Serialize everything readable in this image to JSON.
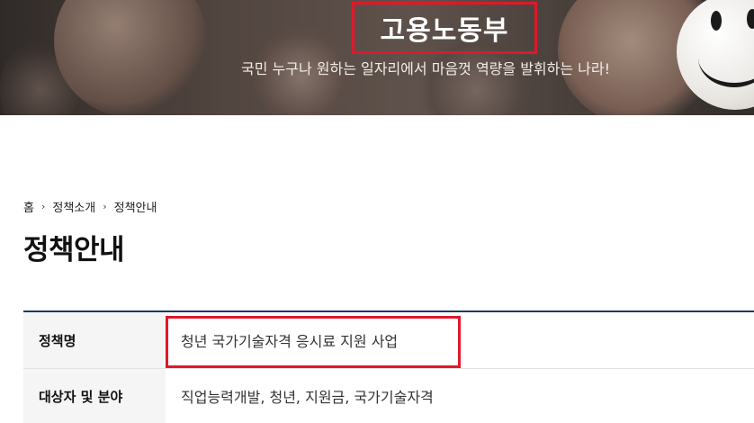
{
  "hero": {
    "title": "고용노동부",
    "subtitle": "국민 누구나 원하는 일자리에서 마음껏 역량을 발휘하는 나라!"
  },
  "breadcrumb": [
    "홈",
    "정책소개",
    "정책안내"
  ],
  "page_title": "정책안내",
  "policy_table": {
    "rows": [
      {
        "header": "정책명",
        "value": "청년 국가기술자격 응시료 지원 사업"
      },
      {
        "header": "대상자 및 분야",
        "value": "직업능력개발, 청년, 지원금, 국가기술자격"
      }
    ]
  },
  "colors": {
    "highlight": "#e0182a",
    "table_top_border": "#1e3a5c",
    "header_cell_bg": "#f5f5f5"
  }
}
